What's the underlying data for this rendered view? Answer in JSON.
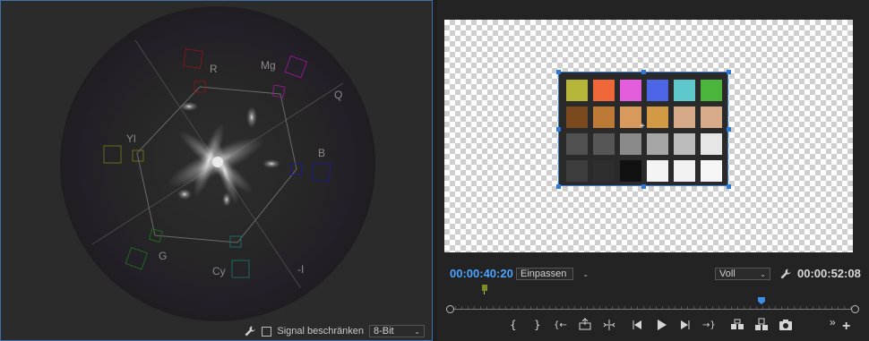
{
  "scope": {
    "labels": {
      "r": "R",
      "mg": "Mg",
      "q": "Q",
      "yl": "Yl",
      "b": "B",
      "g": "G",
      "cy": "Cy",
      "i": "-I"
    },
    "footer": {
      "signal_label": "Signal beschränken",
      "bit_depth": "8-Bit"
    },
    "target_colors": {
      "red": "#7a1a1a",
      "magenta": "#8a1a8a",
      "yellow": "#6c6a1c",
      "blue": "#1c1c8a",
      "green": "#1c6a1c",
      "cyan": "#1c6a6a"
    }
  },
  "monitor": {
    "timecode_current": "00:00:40:20",
    "fit_option": "Einpassen",
    "quality_option": "Voll",
    "timecode_duration": "00:00:52:08",
    "swatches": [
      [
        "#b6b63a",
        "#f0683a",
        "#e35ddc",
        "#4d66e8",
        "#5ec8cc",
        "#4ab43c"
      ],
      [
        "#7a4a1e",
        "#bc7a36",
        "#d89a5c",
        "#d39a46",
        "#d6aa88",
        "#d7aa8a"
      ],
      [
        "#505050",
        "#555555",
        "#8a8a8a",
        "#a6a6a6",
        "#bcbcbc",
        "#e6e6e6"
      ],
      [
        "#3c3c3c",
        "#2e2e2e",
        "#111111",
        "#f4f4f4",
        "#f2f2f2",
        "#f6f6f6"
      ]
    ],
    "transport_icons": [
      "mark-in-icon",
      "mark-out-icon",
      "go-to-in-icon",
      "lift-icon",
      "insert-icon",
      "step-back-icon",
      "play-icon",
      "step-forward-icon",
      "go-to-out-icon",
      "extract-icon",
      "overwrite-icon",
      "export-frame-icon"
    ],
    "more_label": "»",
    "add_label": "+"
  }
}
